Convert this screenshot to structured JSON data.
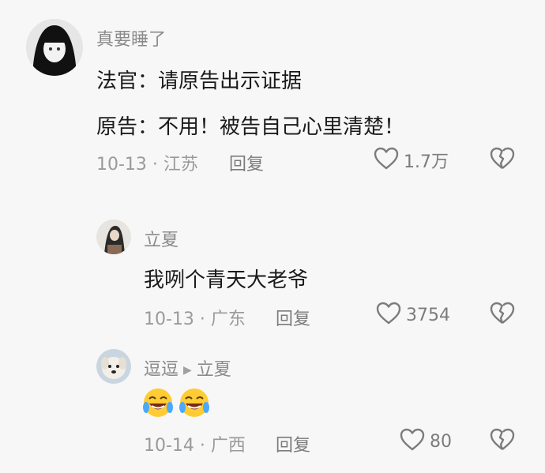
{
  "comments": [
    {
      "username": "真要睡了",
      "lines": [
        "法官：请原告出示证据",
        "原告：不用！被告自己心里清楚！"
      ],
      "date": "10-13",
      "location": "江苏",
      "reply_label": "回复",
      "likes": "1.7万"
    },
    {
      "username": "立夏",
      "lines": [
        "我咧个青天大老爷"
      ],
      "date": "10-13",
      "location": "广东",
      "reply_label": "回复",
      "likes": "3754"
    },
    {
      "username": "逗逗",
      "reply_to": "立夏",
      "emojis": [
        "cry-laugh-emoji",
        "cry-laugh-emoji"
      ],
      "date": "10-14",
      "location": "广西",
      "reply_label": "回复",
      "likes": "80"
    }
  ],
  "meta_separator": " · ",
  "colors": {
    "text": "#1a1a1a",
    "secondary": "#8a8a8a",
    "background": "#f7f7f7"
  },
  "icons": {
    "like": "heart-outline-icon",
    "dislike": "broken-heart-icon",
    "reply_arrow": "triangle-right-icon"
  }
}
